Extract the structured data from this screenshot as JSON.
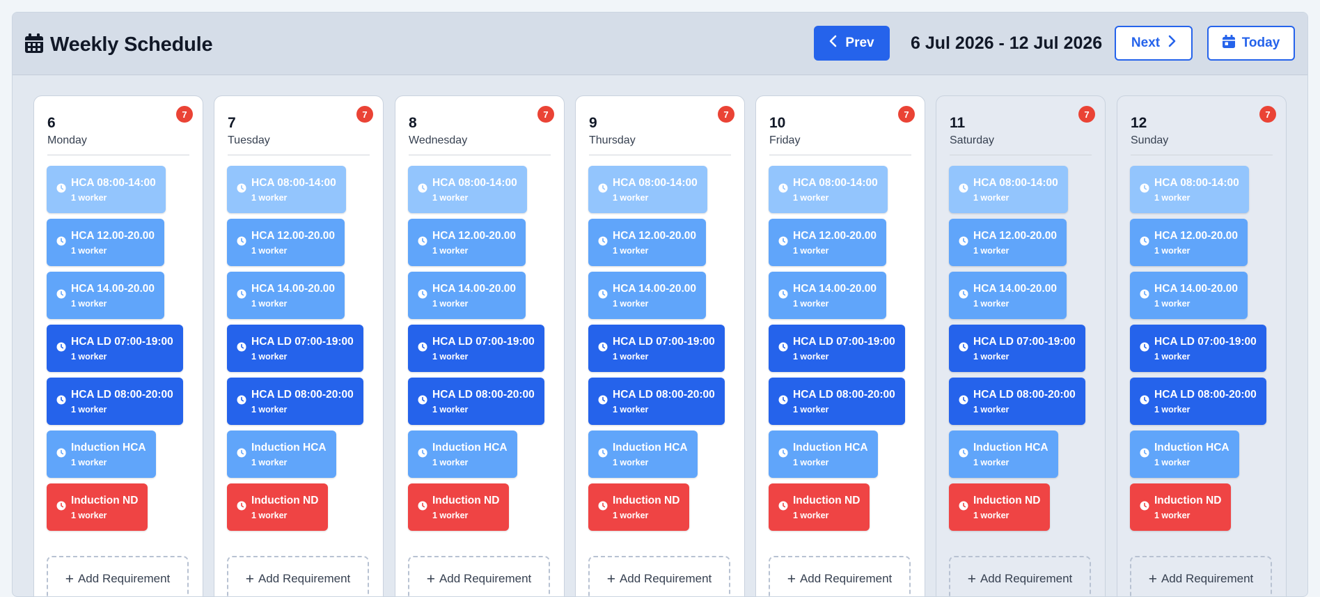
{
  "app": {
    "title": "Weekly Schedule"
  },
  "nav": {
    "prev_label": "Prev",
    "date_range": "6 Jul 2026 - 12 Jul 2026",
    "next_label": "Next",
    "today_label": "Today"
  },
  "add_requirement_label": "Add Requirement",
  "colors": {
    "accent": "#2563eb",
    "shift_light": "#93c5fd",
    "shift_mid": "#60a5fa",
    "shift_dark": "#2563eb",
    "shift_red": "#ef4444",
    "badge": "#ea4335"
  },
  "days": [
    {
      "num": "6",
      "name": "Monday",
      "count": "7",
      "weekend": false
    },
    {
      "num": "7",
      "name": "Tuesday",
      "count": "7",
      "weekend": false
    },
    {
      "num": "8",
      "name": "Wednesday",
      "count": "7",
      "weekend": false
    },
    {
      "num": "9",
      "name": "Thursday",
      "count": "7",
      "weekend": false
    },
    {
      "num": "10",
      "name": "Friday",
      "count": "7",
      "weekend": false
    },
    {
      "num": "11",
      "name": "Saturday",
      "count": "7",
      "weekend": true
    },
    {
      "num": "12",
      "name": "Sunday",
      "count": "7",
      "weekend": true
    }
  ],
  "shifts": [
    {
      "title": "HCA 08:00-14:00",
      "workers": "1 worker",
      "tone": "light"
    },
    {
      "title": "HCA 12.00-20.00",
      "workers": "1 worker",
      "tone": "mid"
    },
    {
      "title": "HCA 14.00-20.00",
      "workers": "1 worker",
      "tone": "mid"
    },
    {
      "title": "HCA LD 07:00-19:00",
      "workers": "1 worker",
      "tone": "dark"
    },
    {
      "title": "HCA LD 08:00-20:00",
      "workers": "1 worker",
      "tone": "dark"
    },
    {
      "title": "Induction HCA",
      "workers": "1 worker",
      "tone": "mid"
    },
    {
      "title": "Induction ND",
      "workers": "1 worker",
      "tone": "red"
    }
  ]
}
